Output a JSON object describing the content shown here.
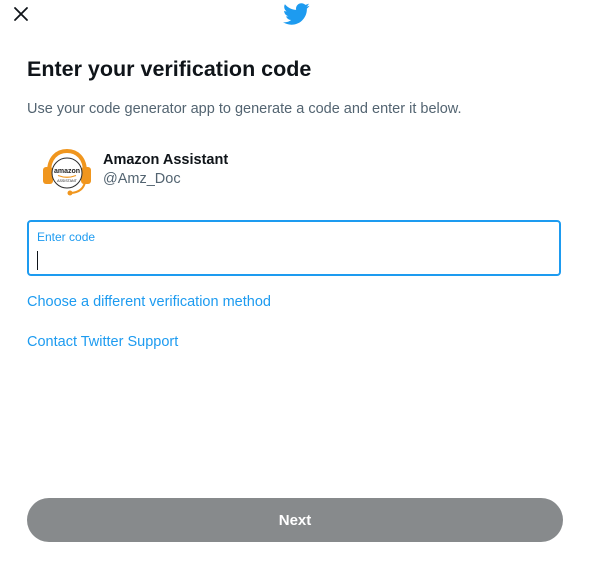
{
  "header": {
    "close_icon": "close-icon",
    "logo_icon": "twitter-bird-icon",
    "brand_color": "#1d9bf0"
  },
  "main": {
    "title": "Enter your verification code",
    "subtitle": "Use your code generator app to generate a code and enter it below."
  },
  "account": {
    "name": "Amazon Assistant",
    "handle": "@Amz_Doc",
    "avatar_text_top": "amazon",
    "avatar_text_bottom": "ASSISTANT"
  },
  "code_input": {
    "label": "Enter code",
    "value": ""
  },
  "links": {
    "different_method": "Choose a different verification method",
    "contact_support": "Contact Twitter Support"
  },
  "footer": {
    "next_label": "Next",
    "next_color": "#878a8c"
  }
}
